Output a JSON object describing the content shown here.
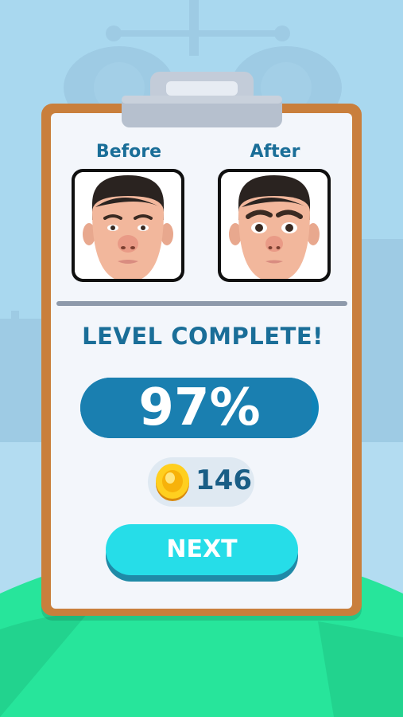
{
  "before_label": "Before",
  "after_label": "After",
  "title": "LEVEL COMPLETE!",
  "score": {
    "text": "97%",
    "value": 0.97
  },
  "coins": {
    "count": "146"
  },
  "next_button_label": "NEXT",
  "colors": {
    "sky": "#a9d8ef",
    "clipboard": "#c97f3c",
    "paper": "#f3f6fb",
    "title_text": "#1a6e98",
    "score_bar": "#0f83b8",
    "next_button": "#26dde8",
    "floor": "#27e59b"
  },
  "icons": [
    "coin-icon",
    "clipboard-clip-icon"
  ]
}
